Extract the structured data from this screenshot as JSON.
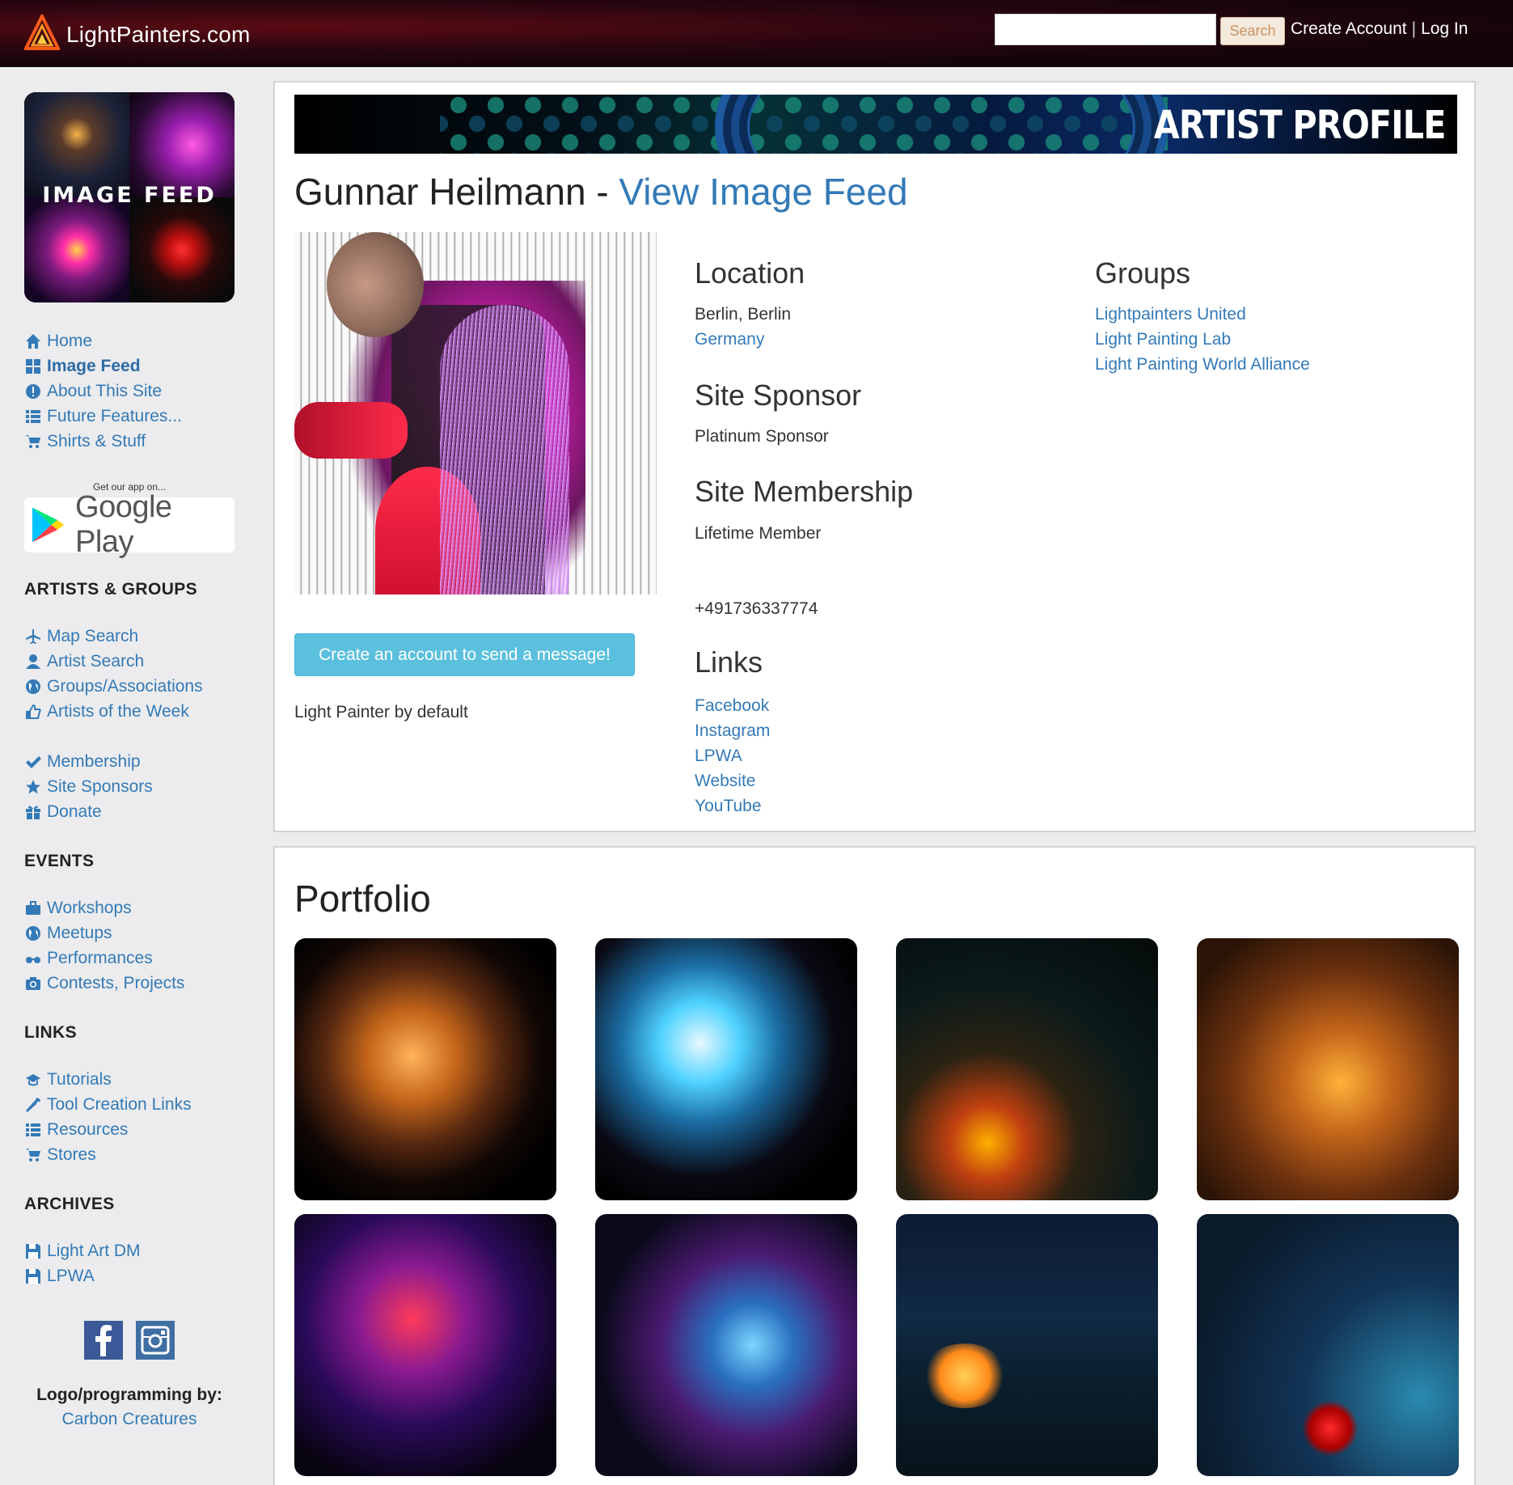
{
  "header": {
    "brand": "LightPainters.com",
    "search_placeholder": "",
    "search_button": "Search",
    "create_account": "Create Account",
    "separator": "|",
    "log_in": "Log In"
  },
  "sidebar": {
    "feed_banner": "IMAGE FEED",
    "main_nav": [
      {
        "label": "Home",
        "icon": "home-icon"
      },
      {
        "label": "Image Feed",
        "icon": "grid-icon"
      },
      {
        "label": "About This Site",
        "icon": "info-icon"
      },
      {
        "label": "Future Features...",
        "icon": "list-icon"
      },
      {
        "label": "Shirts & Stuff",
        "icon": "cart-icon"
      }
    ],
    "get_app": "Get our app on...",
    "google_play": "Google Play",
    "artists_title": "ARTISTS & GROUPS",
    "artists_nav": [
      {
        "label": "Map Search",
        "icon": "plane-icon"
      },
      {
        "label": "Artist Search",
        "icon": "user-icon"
      },
      {
        "label": "Groups/Associations",
        "icon": "globe-icon"
      },
      {
        "label": "Artists of the Week",
        "icon": "thumbs-up-icon"
      }
    ],
    "member_nav": [
      {
        "label": "Membership",
        "icon": "check-icon"
      },
      {
        "label": "Site Sponsors",
        "icon": "star-icon"
      },
      {
        "label": "Donate",
        "icon": "gift-icon"
      }
    ],
    "events_title": "EVENTS",
    "events_nav": [
      {
        "label": "Workshops",
        "icon": "briefcase-icon"
      },
      {
        "label": "Meetups",
        "icon": "globe-icon"
      },
      {
        "label": "Performances",
        "icon": "glasses-icon"
      },
      {
        "label": "Contests, Projects",
        "icon": "camera-icon"
      }
    ],
    "links_title": "LINKS",
    "links_nav": [
      {
        "label": "Tutorials",
        "icon": "grad-cap-icon"
      },
      {
        "label": "Tool Creation Links",
        "icon": "wrench-icon"
      },
      {
        "label": "Resources",
        "icon": "list-icon"
      },
      {
        "label": "Stores",
        "icon": "cart-icon"
      }
    ],
    "archives_title": "ARCHIVES",
    "archives_nav": [
      {
        "label": "Light Art DM",
        "icon": "floppy-icon"
      },
      {
        "label": "LPWA",
        "icon": "floppy-icon"
      }
    ],
    "credit_label": "Logo/programming by:",
    "credit_link": "Carbon Creatures"
  },
  "profile": {
    "hero_title": "ARTIST PROFILE",
    "name": "Gunnar Heilmann",
    "dash": " - ",
    "feed_link": "View Image Feed",
    "message_button": "Create an account to send a message!",
    "role": "Light Painter by default",
    "location_title": "Location",
    "city": "Berlin, Berlin",
    "country": "Germany",
    "sponsor_title": "Site Sponsor",
    "sponsor_level": "Platinum Sponsor",
    "membership_title": "Site Membership",
    "membership_level": "Lifetime Member",
    "phone": "+491736337774",
    "links_title": "Links",
    "links": [
      "Facebook",
      "Instagram",
      "LPWA",
      "Website",
      "YouTube"
    ],
    "groups_title": "Groups",
    "groups": [
      "Lightpainters United",
      "Light Painting Lab",
      "Light Painting World Alliance"
    ]
  },
  "portfolio": {
    "title": "Portfolio"
  },
  "colors": {
    "link": "#337ab7",
    "message_button": "#5bc0de",
    "page_bg": "#ececee"
  }
}
